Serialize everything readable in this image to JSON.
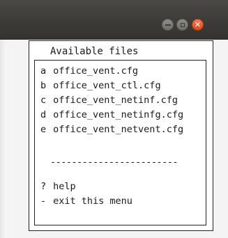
{
  "window": {
    "buttons": {
      "minimize_icon": "minimize-icon",
      "maximize_icon": "maximize-icon",
      "close_icon": "close-icon",
      "close_color": "#df4b16"
    }
  },
  "menu": {
    "title": "Available files",
    "files": [
      {
        "key": "a",
        "name": "office_vent.cfg"
      },
      {
        "key": "b",
        "name": "office_vent_ctl.cfg"
      },
      {
        "key": "c",
        "name": "office_vent_netinf.cfg"
      },
      {
        "key": "d",
        "name": "office_vent_netinfg.cfg"
      },
      {
        "key": "e",
        "name": "office_vent_netvent.cfg"
      }
    ],
    "separator": "------------------------",
    "help": {
      "key": "?",
      "label": "help"
    },
    "exit": {
      "key": "-",
      "label": "exit this menu"
    }
  }
}
